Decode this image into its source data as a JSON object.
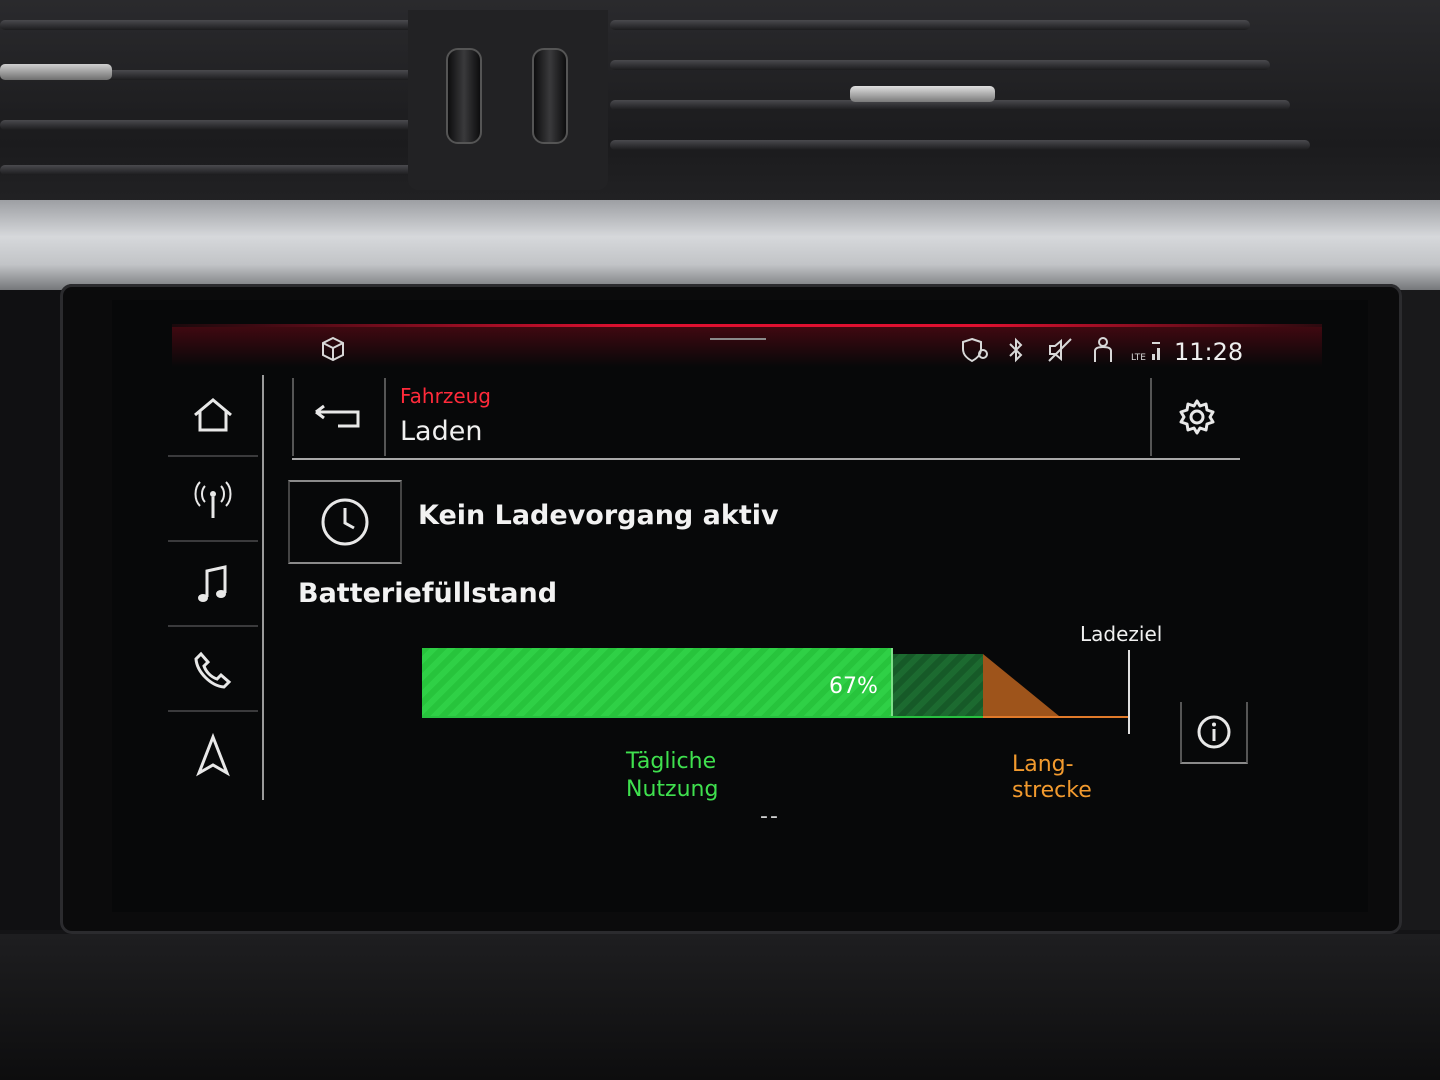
{
  "status_bar": {
    "time": "11:28",
    "icons": [
      "cube-icon",
      "shield-location-icon",
      "bluetooth-icon",
      "mute-icon",
      "seat-person-icon",
      "lte-signal-icon"
    ]
  },
  "sidebar": {
    "items": [
      {
        "icon": "home-icon"
      },
      {
        "icon": "radio-antenna-icon"
      },
      {
        "icon": "music-note-icon"
      },
      {
        "icon": "phone-icon"
      },
      {
        "icon": "navigation-icon"
      }
    ]
  },
  "header": {
    "breadcrumb": "Fahrzeug",
    "title": "Laden"
  },
  "charging": {
    "status": "Kein Ladevorgang aktiv",
    "section_title": "Batteriefüllstand",
    "battery_percent_label": "67%",
    "battery_level": 0.67,
    "target_label": "Ladeziel",
    "daily_label_line1": "Tägliche",
    "daily_label_line2": "Nutzung",
    "long_label_line1": "Lang-",
    "long_label_line2": "strecke",
    "dots": "--"
  },
  "colors": {
    "accent_red": "#e01030",
    "battery_green": "#2fd046",
    "daily_green": "#3fe04e",
    "long_orange": "#f29a2e"
  }
}
